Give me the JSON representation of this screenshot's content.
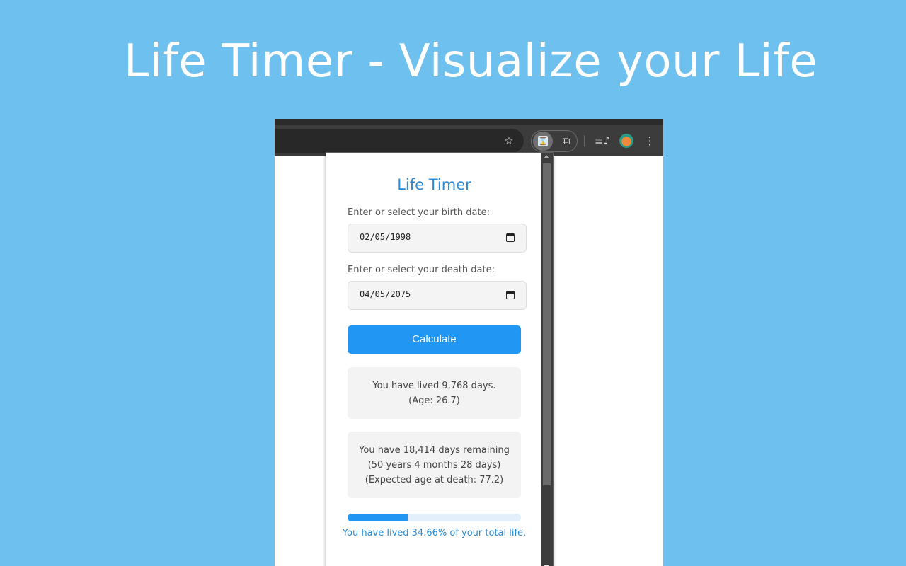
{
  "hero": {
    "title": "Life Timer - Visualize your Life"
  },
  "browser": {
    "toolbar_icons": [
      "star-icon",
      "life-timer-extension-icon",
      "puzzle-icon",
      "media-control-icon",
      "profile-avatar",
      "kebab-menu-icon"
    ],
    "star_glyph": "☆",
    "puzzle_glyph": "⧉",
    "media_glyph": "≡♪",
    "kebab_glyph": "⋮",
    "hourglass_glyph": "⌛"
  },
  "popup": {
    "title": "Life Timer",
    "birth_label": "Enter or select your birth date:",
    "birth_value": "02/05/1998",
    "death_label": "Enter or select your death date:",
    "death_value": "04/05/2075",
    "calculate_label": "Calculate",
    "lived_line1": "You have lived 9,768 days.",
    "lived_line2": "(Age: 26.7)",
    "remaining_line1": "You have 18,414 days remaining",
    "remaining_line2": "(50 years 4 months 28 days)",
    "remaining_line3": "(Expected age at death: 77.2)",
    "progress_percent": 34.66,
    "progress_label": "You have lived 34.66% of your total life."
  },
  "colors": {
    "background": "#6ec0ef",
    "accent": "#2196f3",
    "title_blue": "#2b8bd6"
  }
}
